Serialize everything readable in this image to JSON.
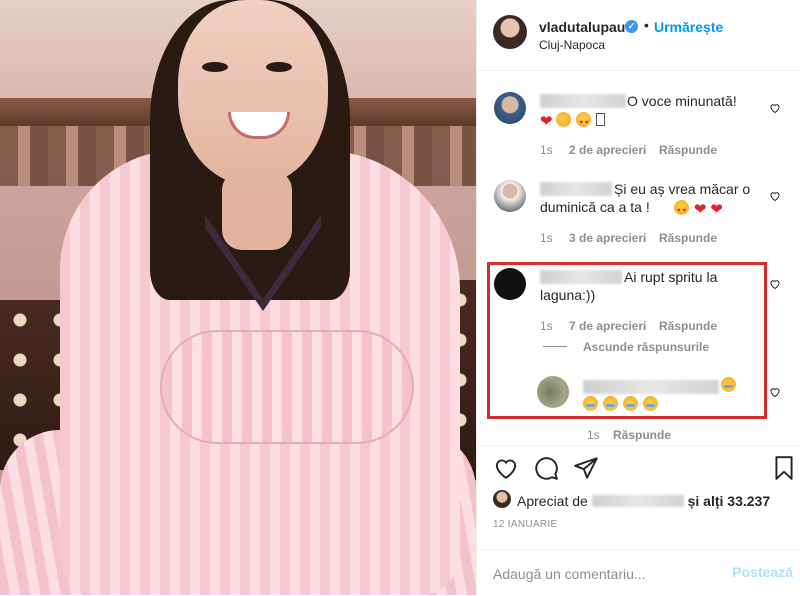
{
  "header": {
    "username": "vladutalupau",
    "verified_icon": "verified-badge-icon",
    "separator": "•",
    "follow_label": "Urmărește",
    "location": "Cluj-Napoca"
  },
  "comments": [
    {
      "text": "O voce minunată!",
      "time": "1s",
      "likes": "2 de aprecieri",
      "reply": "Răspunde"
    },
    {
      "text": "Și eu aș vrea măcar o duminică ca a ta !",
      "time": "1s",
      "likes": "3 de aprecieri",
      "reply": "Răspunde"
    },
    {
      "text": "Ai rupt spritu la laguna:))",
      "time": "1s",
      "likes": "7 de aprecieri",
      "reply": "Răspunde",
      "hide_replies": "Ascunde răspunsurile"
    },
    {
      "text": "",
      "time": "1s",
      "reply": "Răspunde"
    }
  ],
  "actions": {
    "liked_prefix": "Apreciat de",
    "liked_suffix": "și alți 33.237",
    "date": "12 IANUARIE"
  },
  "add_comment": {
    "placeholder": "Adaugă un comentariu...",
    "post_label": "Postează"
  },
  "colors": {
    "accent": "#0095f6",
    "highlight_box": "#d82b2b",
    "muted": "#8e8e8e"
  }
}
